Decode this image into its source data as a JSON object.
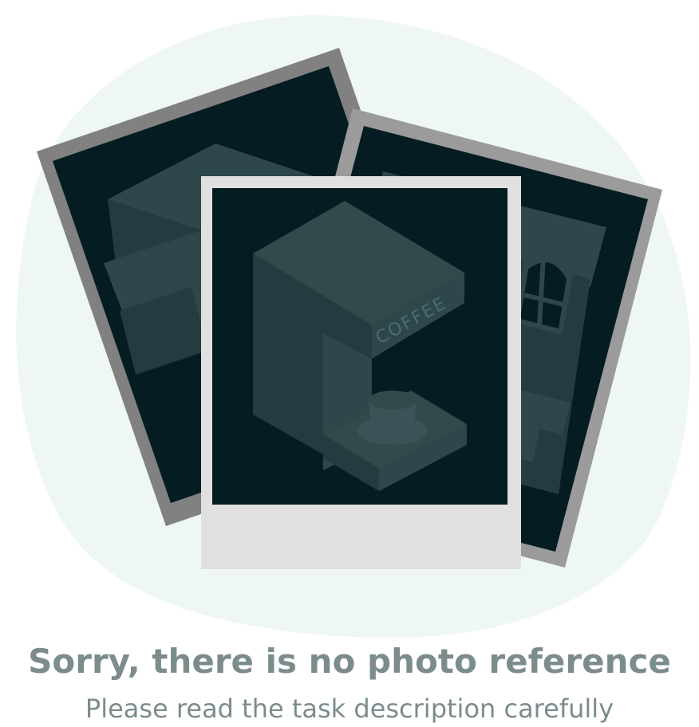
{
  "colors": {
    "blob": "#eff7f6",
    "dark_frame": "#818181",
    "mid_frame": "#9b9b9b",
    "front_frame": "#e0e0e0",
    "photo_bg": "#041c22",
    "object": "#2e474b",
    "object_dark": "#243c40",
    "text": "#7c8c8c"
  },
  "illustration": {
    "front_photo_label": "COFFEE"
  },
  "message": {
    "title": "Sorry, there is no photo reference",
    "subtitle": "Please read the task description carefully"
  }
}
